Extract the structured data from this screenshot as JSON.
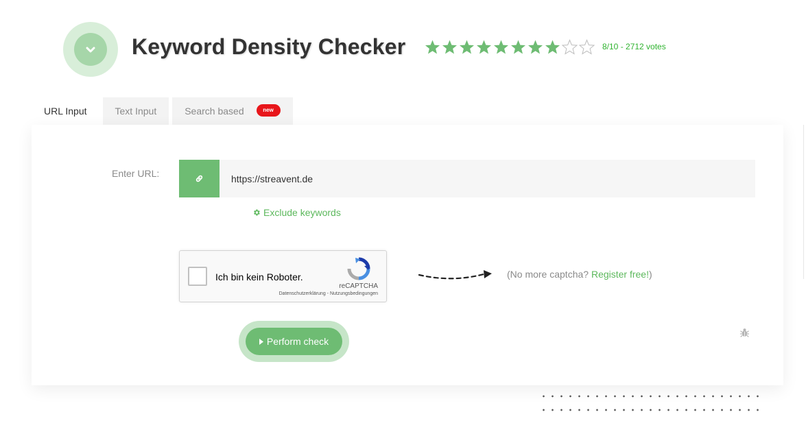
{
  "header": {
    "title": "Keyword Density Checker",
    "logo_icon": "chevron-down-icon",
    "rating": {
      "value": 8,
      "max": 10,
      "stars_filled": 8,
      "stars_total": 10,
      "text": "8/10 - 2712 votes"
    }
  },
  "tabs": [
    {
      "label": "URL Input",
      "active": true
    },
    {
      "label": "Text Input",
      "active": false
    },
    {
      "label": "Search based",
      "active": false,
      "badge": "new"
    }
  ],
  "form": {
    "url_label": "Enter URL:",
    "url_value": "https://streavent.de",
    "url_icon": "link-icon",
    "exclude_keywords": "Exclude keywords",
    "exclude_icon": "gear-icon"
  },
  "captcha": {
    "checkbox_label": "Ich bin kein Roboter.",
    "brand": "reCAPTCHA",
    "links": "Datenschutzerklärung - Nutzungsbedingungen",
    "promo_prefix": "(No more captcha? ",
    "promo_link": "Register free!",
    "promo_suffix": ")"
  },
  "actions": {
    "perform_check": "Perform check",
    "bug_icon": "bug-icon"
  },
  "colors": {
    "accent": "#6ebc73",
    "accent_light": "#c6e5c8",
    "star": "#6ebc73",
    "rating_text": "#2fb32f",
    "badge": "#e8161b",
    "link": "#5cb85c"
  }
}
